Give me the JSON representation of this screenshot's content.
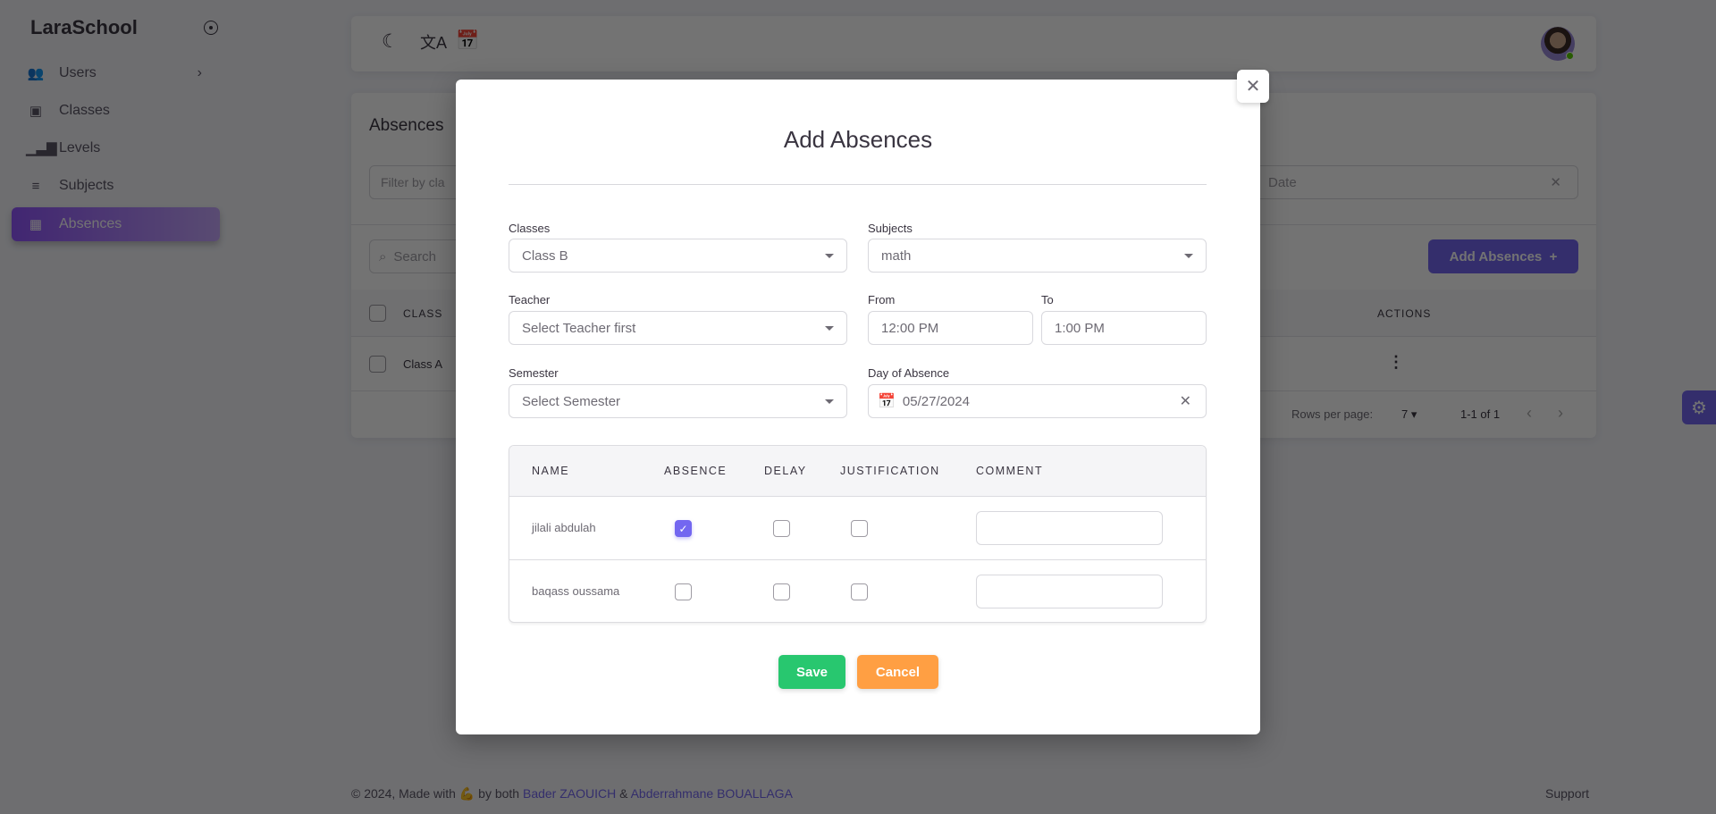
{
  "sidebar": {
    "logo": "LaraSchool",
    "items": [
      {
        "label": "Users",
        "icon": "users-icon"
      },
      {
        "label": "Classes",
        "icon": "classes-icon"
      },
      {
        "label": "Levels",
        "icon": "levels-icon"
      },
      {
        "label": "Subjects",
        "icon": "subjects-icon"
      },
      {
        "label": "Absences",
        "icon": "absences-icon",
        "active": true
      }
    ]
  },
  "header": {
    "icons": [
      "moon-icon",
      "translate-icon",
      "calendar-icon"
    ]
  },
  "page": {
    "title": "Absences",
    "filter_class_placeholder": "Filter by cla",
    "filter_date_placeholder": "Date",
    "search_placeholder": "Search",
    "add_button": "Add Absences",
    "table": {
      "headers": [
        "CLASS",
        "ACTIONS"
      ],
      "rows": [
        [
          "Class A"
        ]
      ]
    },
    "pagination": {
      "rows_per_page_label": "Rows per page:",
      "rows_per_page": "7",
      "range": "1-1 of 1"
    }
  },
  "footer": {
    "prefix": "© 2024, Made with",
    "by": "by both",
    "author1": "Bader ZAOUICH",
    "amp": "&",
    "author2": "Abderrahmane BOUALLAGA",
    "support": "Support"
  },
  "modal": {
    "title": "Add Absences",
    "classes": {
      "label": "Classes",
      "value": "Class B"
    },
    "subjects": {
      "label": "Subjects",
      "value": "math"
    },
    "teacher": {
      "label": "Teacher",
      "value": "Select Teacher first"
    },
    "from": {
      "label": "From",
      "value": "12:00 PM"
    },
    "to": {
      "label": "To",
      "value": "1:00 PM"
    },
    "semester": {
      "label": "Semester",
      "value": "Select Semester"
    },
    "day": {
      "label": "Day of Absence",
      "value": "05/27/2024"
    },
    "table": {
      "headers": [
        "NAME",
        "ABSENCE",
        "DELAY",
        "JUSTIFICATION",
        "COMMENT"
      ],
      "rows": [
        {
          "name": "jilali abdulah",
          "absence": true,
          "delay": false,
          "justification": false,
          "comment": ""
        },
        {
          "name": "baqass oussama",
          "absence": false,
          "delay": false,
          "justification": false,
          "comment": ""
        }
      ]
    },
    "save": "Save",
    "cancel": "Cancel"
  },
  "colors": {
    "primary": "#7367f0",
    "save": "#28c76f",
    "cancel": "#ff9f43"
  }
}
